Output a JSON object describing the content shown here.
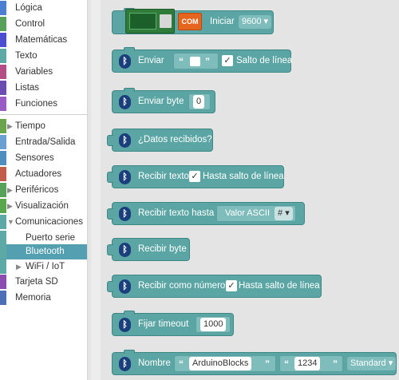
{
  "toolbox": {
    "categories": [
      {
        "label": "Lógica",
        "color": "#4c7fd1"
      },
      {
        "label": "Control",
        "color": "#58a15a"
      },
      {
        "label": "Matemáticas",
        "color": "#4d4dd1"
      },
      {
        "label": "Texto",
        "color": "#5ca9a6"
      },
      {
        "label": "Variables",
        "color": "#b44c85"
      },
      {
        "label": "Listas",
        "color": "#6c4cb0"
      },
      {
        "label": "Funciones",
        "color": "#9a5bc4"
      },
      {
        "label": "Tiempo",
        "color": "#6aa54e"
      },
      {
        "label": "Entrada/Salida",
        "color": "#6aa0d1"
      },
      {
        "label": "Sensores",
        "color": "#4f8fbf"
      },
      {
        "label": "Actuadores",
        "color": "#c45c4c"
      },
      {
        "label": "Periféricos",
        "color": "#58a15a"
      },
      {
        "label": "Visualización",
        "color": "#5aa84e"
      },
      {
        "label": "Comunicaciones",
        "color": "#5ca9a6"
      },
      {
        "label": "Puerto serie",
        "color": "#5ca9a6"
      },
      {
        "label": "Bluetooth",
        "color": "#5ca9a6"
      },
      {
        "label": "WiFi / IoT",
        "color": "#5ca9a6"
      },
      {
        "label": "Tarjeta SD",
        "color": "#8c4cb0"
      },
      {
        "label": "Memoria",
        "color": "#4c6fb5"
      }
    ]
  },
  "blocks": {
    "init": {
      "label": "Iniciar",
      "baud": "9600",
      "com_label": "COM"
    },
    "send": {
      "label": "Enviar",
      "checkbox": "✓",
      "checkbox_label": "Salto de línea"
    },
    "send_byte": {
      "label": "Enviar byte",
      "value": "0"
    },
    "data_received": {
      "label": "¿Datos recibidos?"
    },
    "receive_text": {
      "label": "Recibir texto",
      "checkbox": "✓",
      "checkbox_label": "Hasta salto de línea"
    },
    "receive_text_until": {
      "label": "Recibir texto hasta",
      "dropdown": "Valor ASCII",
      "char": "#"
    },
    "receive_byte": {
      "label": "Recibir byte"
    },
    "receive_number": {
      "label": "Recibir como número",
      "checkbox": "✓",
      "checkbox_label": "Hasta salto de línea"
    },
    "timeout": {
      "label": "Fijar timeout",
      "value": "1000"
    },
    "name": {
      "label": "Nombre",
      "name_value": "ArduinoBlocks",
      "pin_value": "1234",
      "mode": "Standard"
    }
  },
  "symbols": {
    "bluetooth": "ᛒ",
    "open_quote": "“",
    "close_quote": "”",
    "dropdown_arrow": "▾",
    "expand_arrow": "▶",
    "collapse_arrow": "▼"
  },
  "colors": {
    "block": "#5ba5a5",
    "selected_category": "#55a0b0",
    "bluetooth_badge": "#1b3f7c",
    "com_badge": "#e5641e"
  }
}
